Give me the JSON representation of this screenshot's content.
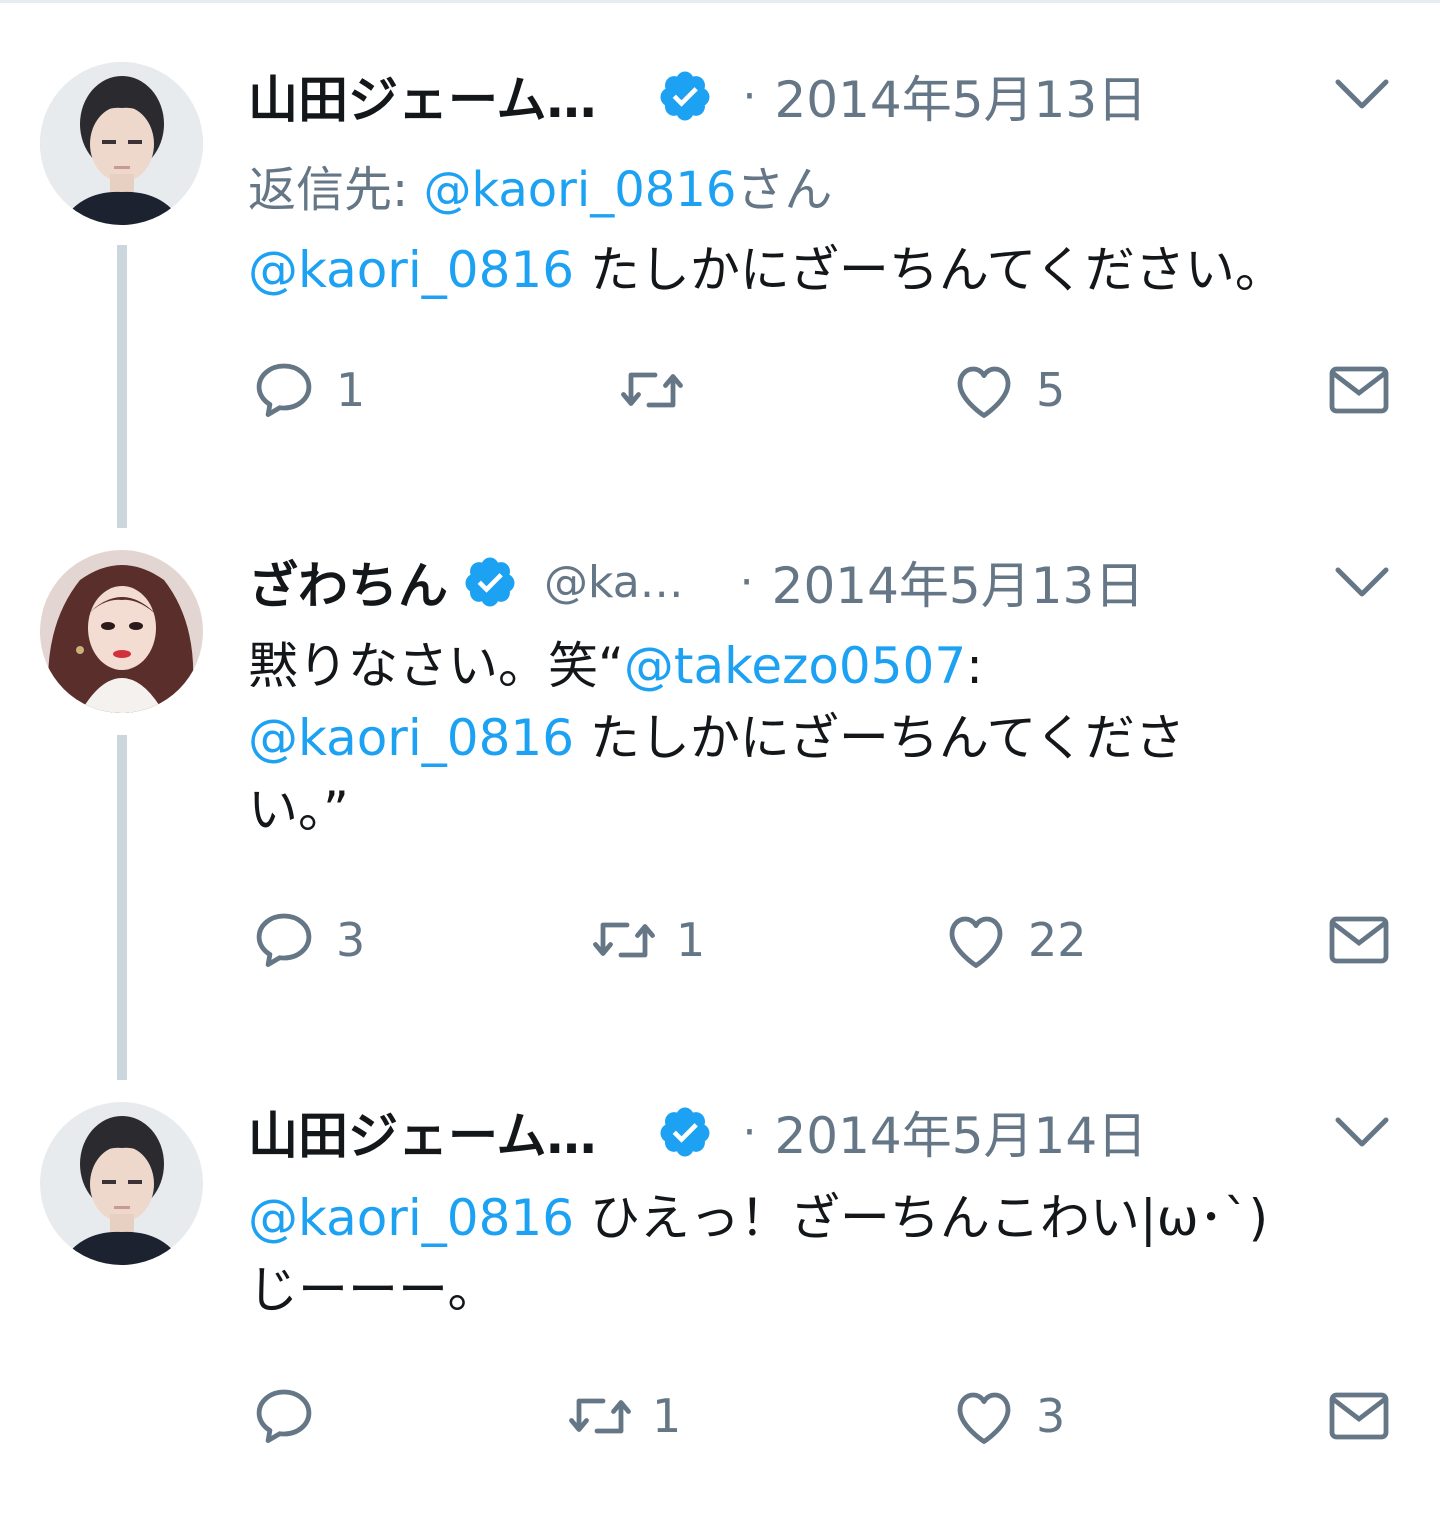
{
  "colors": {
    "link": "#1da1f2",
    "muted": "#657786",
    "thread_line": "#ccd6dd",
    "verified": "#1da1f2"
  },
  "tweets": [
    {
      "name": "山田ジェーム…",
      "handle": "",
      "date": "2014年5月13日",
      "reply_prefix": "返信先: ",
      "reply_handle": "@kaori_0816",
      "reply_suffix": "さん",
      "text_link": "@kaori_0816",
      "text_line1": " たしかにざーちんてください。",
      "counts": {
        "reply": "1",
        "retweet": "",
        "like": "5"
      }
    },
    {
      "name": "ざわちん",
      "handle": "@ka…",
      "date": "2014年5月13日",
      "text_line1_a": "黙りなさい。笑“",
      "text_line1_link": "@takezo0507",
      "text_line1_b": ":",
      "text_line2_link": "@kaori_0816",
      "text_line2": " たしかにざーちんてくださ",
      "text_line3": "い。”",
      "counts": {
        "reply": "3",
        "retweet": "1",
        "like": "22"
      }
    },
    {
      "name": "山田ジェーム…",
      "handle": "",
      "date": "2014年5月14日",
      "text_line1_link": "@kaori_0816",
      "text_line1": " ひえっ！ざーちんこわい|ω･`)",
      "text_line2": "じーーー。",
      "counts": {
        "reply": "",
        "retweet": "1",
        "like": "3"
      }
    }
  ]
}
